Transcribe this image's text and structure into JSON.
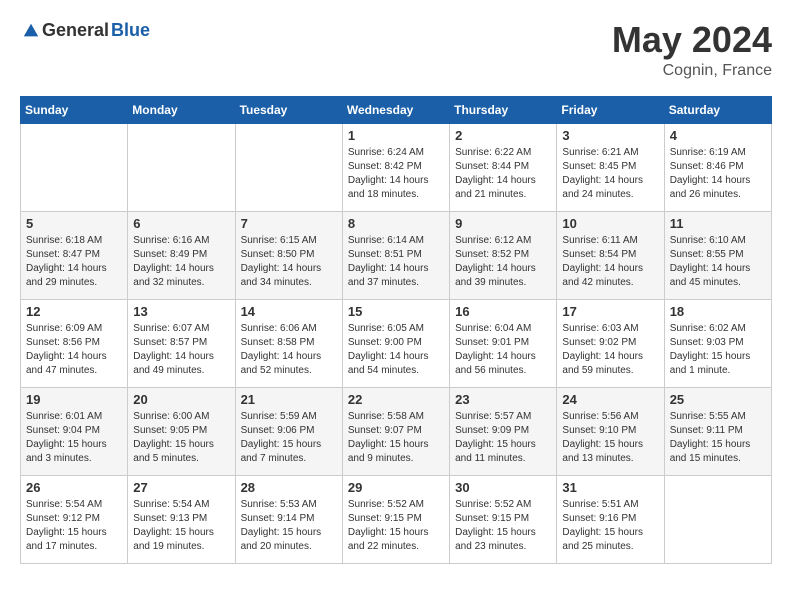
{
  "header": {
    "logo_general": "General",
    "logo_blue": "Blue",
    "month_year": "May 2024",
    "location": "Cognin, France"
  },
  "calendar": {
    "headers": [
      "Sunday",
      "Monday",
      "Tuesday",
      "Wednesday",
      "Thursday",
      "Friday",
      "Saturday"
    ],
    "weeks": [
      [
        {
          "day": "",
          "info": ""
        },
        {
          "day": "",
          "info": ""
        },
        {
          "day": "",
          "info": ""
        },
        {
          "day": "1",
          "info": "Sunrise: 6:24 AM\nSunset: 8:42 PM\nDaylight: 14 hours\nand 18 minutes."
        },
        {
          "day": "2",
          "info": "Sunrise: 6:22 AM\nSunset: 8:44 PM\nDaylight: 14 hours\nand 21 minutes."
        },
        {
          "day": "3",
          "info": "Sunrise: 6:21 AM\nSunset: 8:45 PM\nDaylight: 14 hours\nand 24 minutes."
        },
        {
          "day": "4",
          "info": "Sunrise: 6:19 AM\nSunset: 8:46 PM\nDaylight: 14 hours\nand 26 minutes."
        }
      ],
      [
        {
          "day": "5",
          "info": "Sunrise: 6:18 AM\nSunset: 8:47 PM\nDaylight: 14 hours\nand 29 minutes."
        },
        {
          "day": "6",
          "info": "Sunrise: 6:16 AM\nSunset: 8:49 PM\nDaylight: 14 hours\nand 32 minutes."
        },
        {
          "day": "7",
          "info": "Sunrise: 6:15 AM\nSunset: 8:50 PM\nDaylight: 14 hours\nand 34 minutes."
        },
        {
          "day": "8",
          "info": "Sunrise: 6:14 AM\nSunset: 8:51 PM\nDaylight: 14 hours\nand 37 minutes."
        },
        {
          "day": "9",
          "info": "Sunrise: 6:12 AM\nSunset: 8:52 PM\nDaylight: 14 hours\nand 39 minutes."
        },
        {
          "day": "10",
          "info": "Sunrise: 6:11 AM\nSunset: 8:54 PM\nDaylight: 14 hours\nand 42 minutes."
        },
        {
          "day": "11",
          "info": "Sunrise: 6:10 AM\nSunset: 8:55 PM\nDaylight: 14 hours\nand 45 minutes."
        }
      ],
      [
        {
          "day": "12",
          "info": "Sunrise: 6:09 AM\nSunset: 8:56 PM\nDaylight: 14 hours\nand 47 minutes."
        },
        {
          "day": "13",
          "info": "Sunrise: 6:07 AM\nSunset: 8:57 PM\nDaylight: 14 hours\nand 49 minutes."
        },
        {
          "day": "14",
          "info": "Sunrise: 6:06 AM\nSunset: 8:58 PM\nDaylight: 14 hours\nand 52 minutes."
        },
        {
          "day": "15",
          "info": "Sunrise: 6:05 AM\nSunset: 9:00 PM\nDaylight: 14 hours\nand 54 minutes."
        },
        {
          "day": "16",
          "info": "Sunrise: 6:04 AM\nSunset: 9:01 PM\nDaylight: 14 hours\nand 56 minutes."
        },
        {
          "day": "17",
          "info": "Sunrise: 6:03 AM\nSunset: 9:02 PM\nDaylight: 14 hours\nand 59 minutes."
        },
        {
          "day": "18",
          "info": "Sunrise: 6:02 AM\nSunset: 9:03 PM\nDaylight: 15 hours\nand 1 minute."
        }
      ],
      [
        {
          "day": "19",
          "info": "Sunrise: 6:01 AM\nSunset: 9:04 PM\nDaylight: 15 hours\nand 3 minutes."
        },
        {
          "day": "20",
          "info": "Sunrise: 6:00 AM\nSunset: 9:05 PM\nDaylight: 15 hours\nand 5 minutes."
        },
        {
          "day": "21",
          "info": "Sunrise: 5:59 AM\nSunset: 9:06 PM\nDaylight: 15 hours\nand 7 minutes."
        },
        {
          "day": "22",
          "info": "Sunrise: 5:58 AM\nSunset: 9:07 PM\nDaylight: 15 hours\nand 9 minutes."
        },
        {
          "day": "23",
          "info": "Sunrise: 5:57 AM\nSunset: 9:09 PM\nDaylight: 15 hours\nand 11 minutes."
        },
        {
          "day": "24",
          "info": "Sunrise: 5:56 AM\nSunset: 9:10 PM\nDaylight: 15 hours\nand 13 minutes."
        },
        {
          "day": "25",
          "info": "Sunrise: 5:55 AM\nSunset: 9:11 PM\nDaylight: 15 hours\nand 15 minutes."
        }
      ],
      [
        {
          "day": "26",
          "info": "Sunrise: 5:54 AM\nSunset: 9:12 PM\nDaylight: 15 hours\nand 17 minutes."
        },
        {
          "day": "27",
          "info": "Sunrise: 5:54 AM\nSunset: 9:13 PM\nDaylight: 15 hours\nand 19 minutes."
        },
        {
          "day": "28",
          "info": "Sunrise: 5:53 AM\nSunset: 9:14 PM\nDaylight: 15 hours\nand 20 minutes."
        },
        {
          "day": "29",
          "info": "Sunrise: 5:52 AM\nSunset: 9:15 PM\nDaylight: 15 hours\nand 22 minutes."
        },
        {
          "day": "30",
          "info": "Sunrise: 5:52 AM\nSunset: 9:15 PM\nDaylight: 15 hours\nand 23 minutes."
        },
        {
          "day": "31",
          "info": "Sunrise: 5:51 AM\nSunset: 9:16 PM\nDaylight: 15 hours\nand 25 minutes."
        },
        {
          "day": "",
          "info": ""
        }
      ]
    ]
  }
}
